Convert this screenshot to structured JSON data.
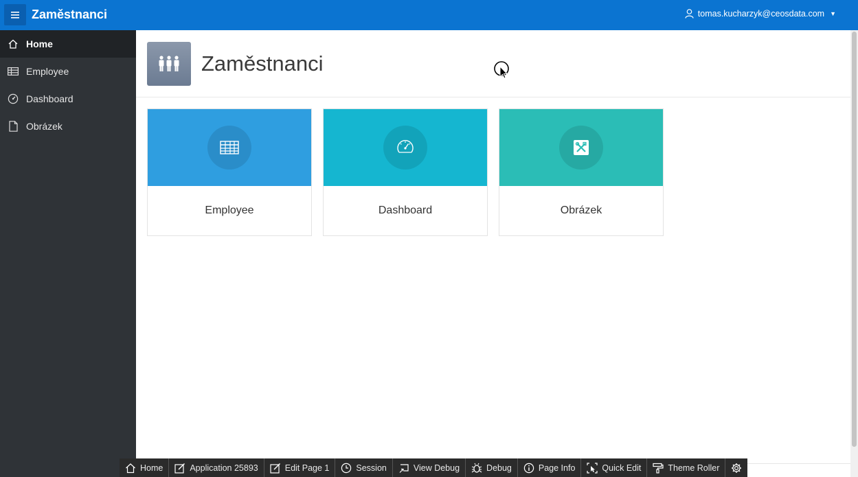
{
  "header": {
    "app_title": "Zaměstnanci",
    "user": "tomas.kucharzyk@ceosdata.com",
    "colors": {
      "header_bg": "#0b74d1",
      "menu_btn": "#0a5fb0"
    }
  },
  "sidebar": {
    "items": [
      {
        "label": "Home",
        "icon": "home-icon",
        "active": true
      },
      {
        "label": "Employee",
        "icon": "table-icon"
      },
      {
        "label": "Dashboard",
        "icon": "gauge-icon"
      },
      {
        "label": "Obrázek",
        "icon": "file-icon"
      }
    ]
  },
  "main": {
    "page_title": "Zaměstnanci",
    "cards": [
      {
        "label": "Employee",
        "icon": "table-icon",
        "color": "#2f9ee0"
      },
      {
        "label": "Dashboard",
        "icon": "gauge-icon",
        "color": "#15b6d0"
      },
      {
        "label": "Obrázek",
        "icon": "tools-icon",
        "color": "#2bbdb6"
      }
    ]
  },
  "devbar": {
    "items": [
      {
        "label": "Home",
        "icon": "home-icon"
      },
      {
        "label": "Application 25893",
        "icon": "edit-icon"
      },
      {
        "label": "Edit Page 1",
        "icon": "edit-icon"
      },
      {
        "label": "Session",
        "icon": "clock-icon"
      },
      {
        "label": "View Debug",
        "icon": "debug-view-icon"
      },
      {
        "label": "Debug",
        "icon": "bug-icon"
      },
      {
        "label": "Page Info",
        "icon": "info-icon"
      },
      {
        "label": "Quick Edit",
        "icon": "quick-edit-icon"
      },
      {
        "label": "Theme Roller",
        "icon": "paint-roller-icon"
      },
      {
        "label": "",
        "icon": "gear-icon"
      }
    ]
  }
}
